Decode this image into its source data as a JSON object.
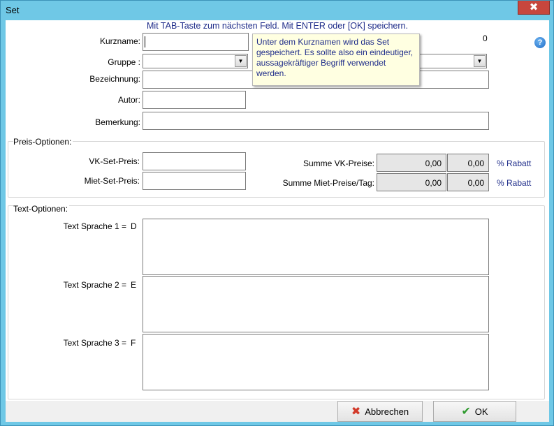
{
  "window": {
    "title": "Set",
    "close_glyph": "✖"
  },
  "hint": "Mit TAB-Taste zum nächsten Feld. Mit ENTER oder [OK] speichern.",
  "counter": "0",
  "help_glyph": "?",
  "tooltip": "Unter dem Kurznamen wird das Set gespeichert. Es sollte also ein eindeutiger, aussagekräftiger Begriff verwendet werden.",
  "fields": {
    "kurzname_label": "Kurzname:",
    "gruppe_label": "Gruppe :",
    "bezeichnung_label": "Bezeichnung:",
    "autor_label": "Autor:",
    "bemerkung_label": "Bemerkung:"
  },
  "preis": {
    "title": "Preis-Optionen:",
    "vk_label": "VK-Set-Preis:",
    "miet_label": "Miet-Set-Preis:",
    "summe_vk_label": "Summe VK-Preise:",
    "summe_miet_label": "Summe Miet-Preise/Tag:",
    "summe_vk_value": "0,00",
    "summe_vk_rabatt_value": "0,00",
    "summe_miet_value": "0,00",
    "summe_miet_rabatt_value": "0,00",
    "rabatt_label": "% Rabatt"
  },
  "text": {
    "title": "Text-Optionen:",
    "sprache1_label": "Text Sprache 1 =",
    "sprache1_code": "D",
    "sprache2_label": "Text Sprache 2 =",
    "sprache2_code": "E",
    "sprache3_label": "Text Sprache 3 =",
    "sprache3_code": "F"
  },
  "buttons": {
    "abbrechen": "Abbrechen",
    "ok": "OK"
  },
  "icons": {
    "cancel": "cancel-x-icon",
    "ok": "checkmark-icon",
    "help": "help-icon",
    "dropdown": "chevron-down-icon"
  }
}
